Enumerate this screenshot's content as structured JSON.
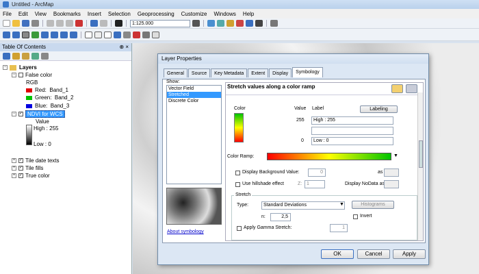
{
  "window": {
    "title": "Untitled - ArcMap"
  },
  "menu": [
    "File",
    "Edit",
    "View",
    "Bookmarks",
    "Insert",
    "Selection",
    "Geoprocessing",
    "Customize",
    "Windows",
    "Help"
  ],
  "toolbar": {
    "scale": "1:125.000"
  },
  "toc": {
    "title": "Table Of Contents",
    "pin": "⊕ ×",
    "layers_label": "Layers",
    "false_color": {
      "name": "False color",
      "rgb_label": "RGB",
      "bands": [
        {
          "label": "Red:",
          "band": "Band_1",
          "color": "#e00000"
        },
        {
          "label": "Green:",
          "band": "Band_2",
          "color": "#00c000"
        },
        {
          "label": "Blue:",
          "band": "Band_3",
          "color": "#0000e0"
        }
      ]
    },
    "ndvi": {
      "name": "NDVI for WCS",
      "value_label": "Value",
      "high": "High : 255",
      "low": "Low : 0"
    },
    "others": [
      "Tile date texts",
      "Tile fills",
      "True color"
    ]
  },
  "dialog": {
    "title": "Layer Properties",
    "tabs": [
      "General",
      "Source",
      "Key Metadata",
      "Extent",
      "Display",
      "Symbology"
    ],
    "show_label": "Show:",
    "show_items": [
      "Vector Field",
      "Stretched",
      "Discrete Color"
    ],
    "heading": "Stretch values along a color ramp",
    "color_col": "Color",
    "value_col": "Value",
    "label_col": "Label",
    "labeling_btn": "Labeling",
    "high_value": "255",
    "high_label": "High : 255",
    "low_value": "0",
    "low_label": "Low : 0",
    "color_ramp_label": "Color Ramp:",
    "display_bg": "Display Background Value:",
    "bg_value": "0",
    "as_label": "as",
    "hillshade": "Use hillshade effect",
    "z_label": "Z:",
    "z_value": "1",
    "nodata": "Display NoData as",
    "stretch_label": "Stretch",
    "type_label": "Type:",
    "type_value": "Standard Deviations",
    "histograms_btn": "Histograms",
    "n_label": "n:",
    "n_value": "2,5",
    "invert": "Invert",
    "gamma": "Apply Gamma Stretch:",
    "gamma_value": "1",
    "about": "About symbology",
    "ok": "OK",
    "cancel": "Cancel",
    "apply": "Apply"
  }
}
